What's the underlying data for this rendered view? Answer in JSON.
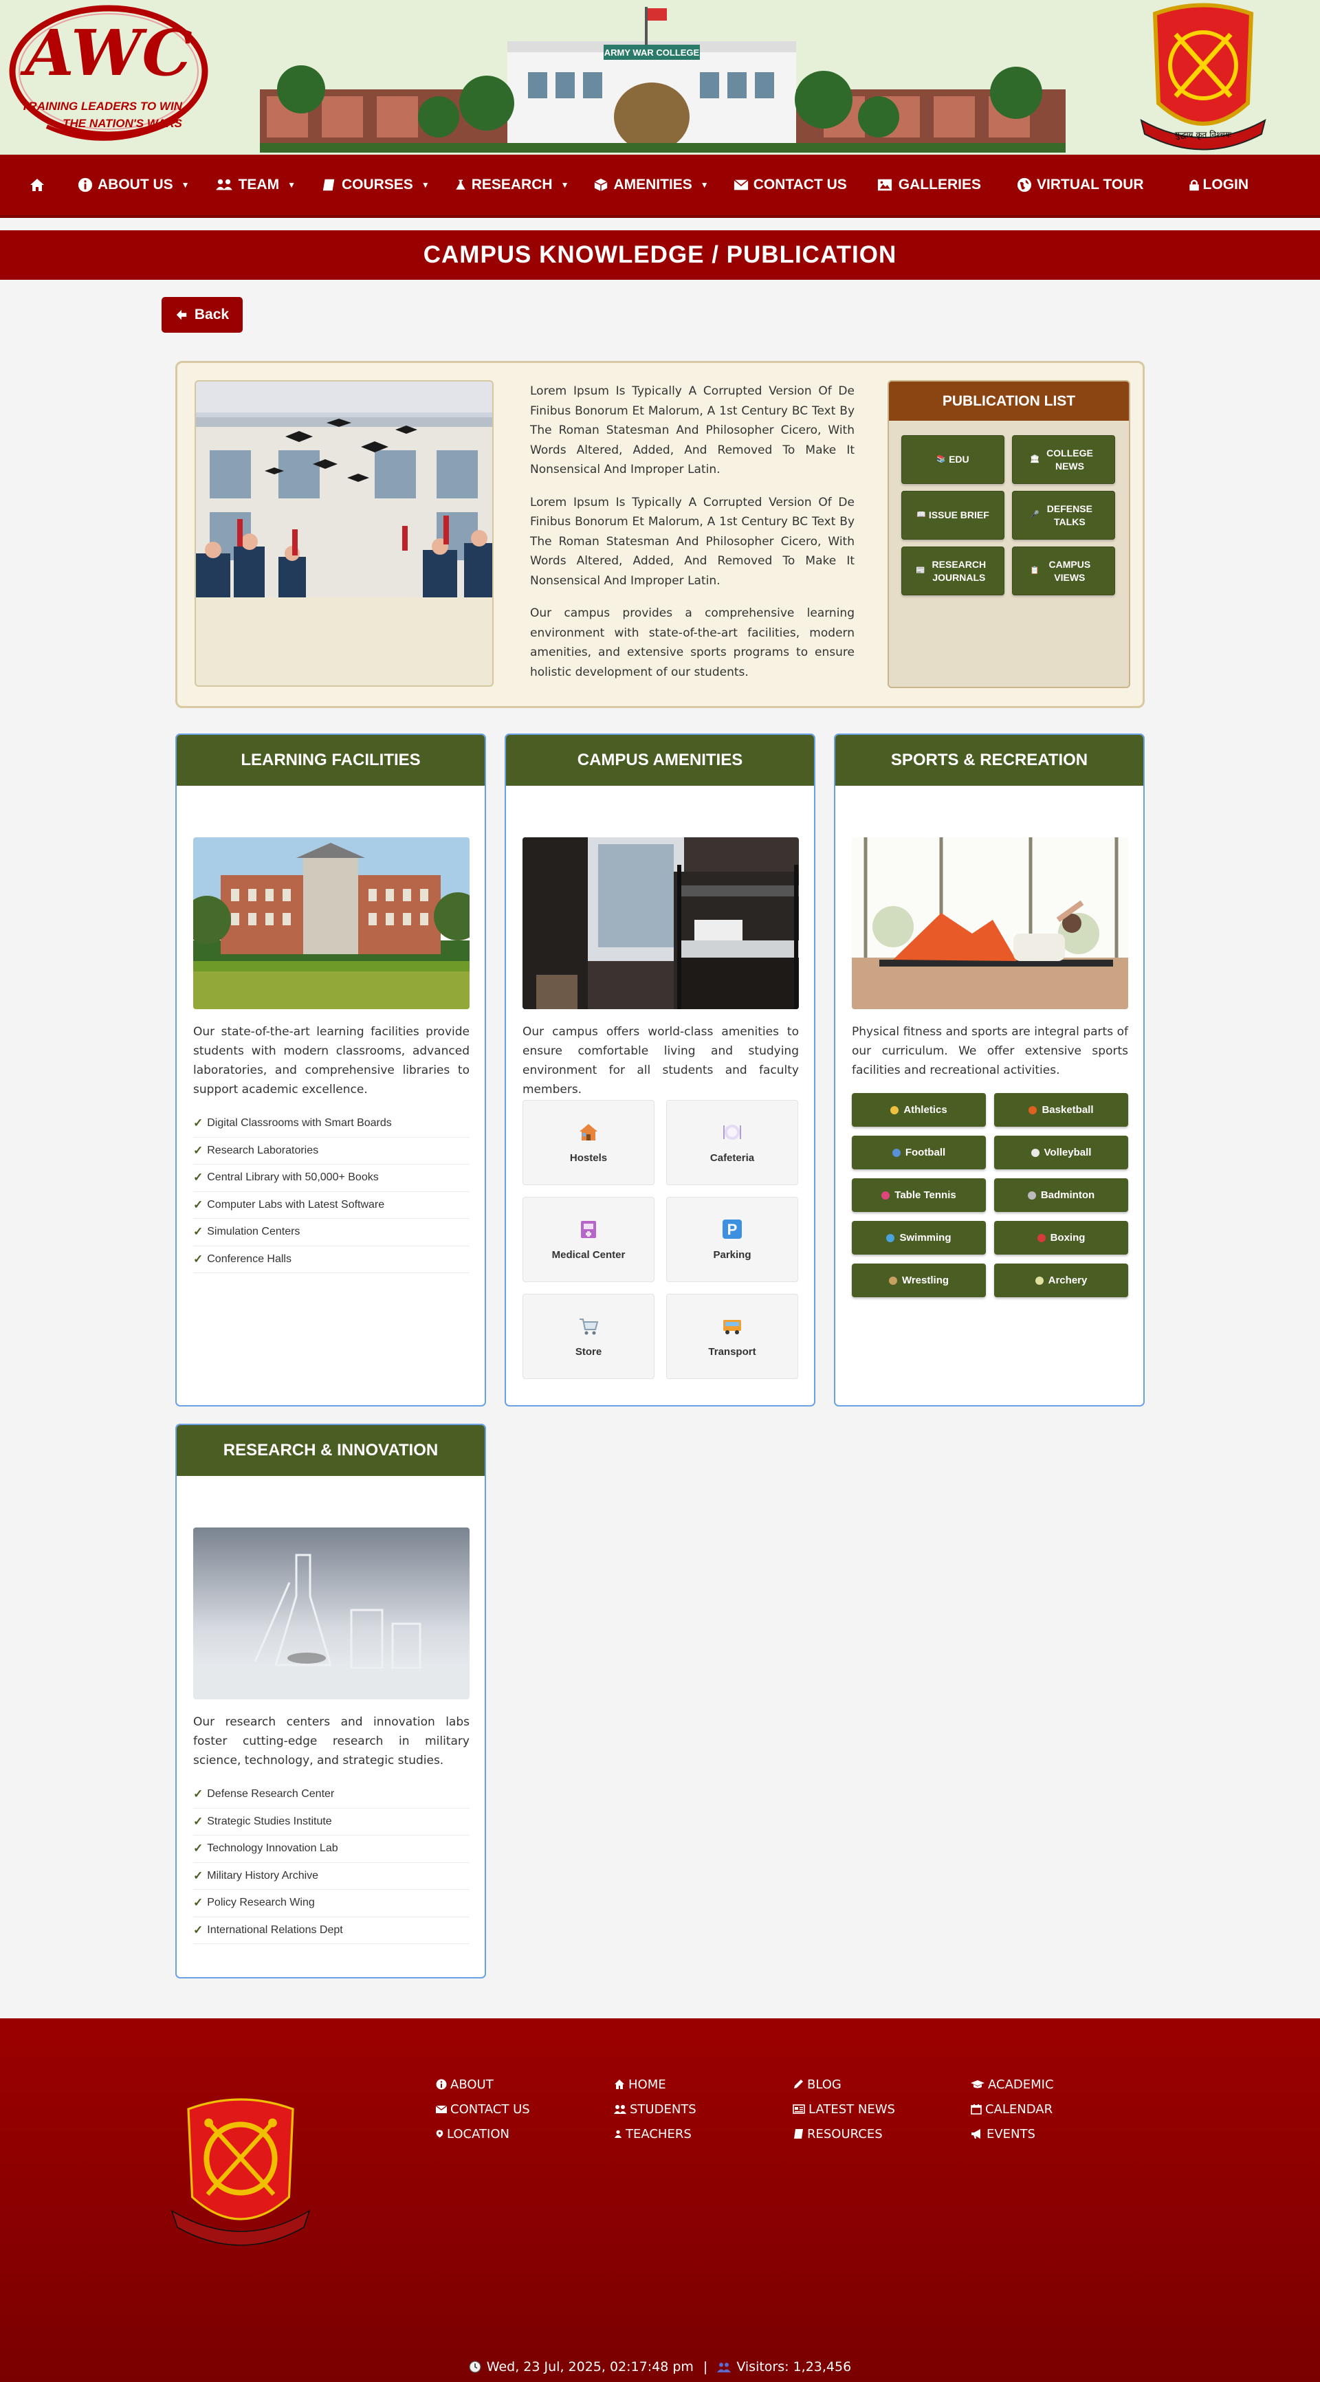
{
  "banner": {
    "logo_text": "AWC",
    "logo_tagline_1": "TRAINING LEADERS TO WIN",
    "logo_tagline_2": "THE NATION'S WARS",
    "college_sign": "ARMY WAR COLLEGE",
    "emblem_motto": "युद्धाय कृत निश्चयः"
  },
  "nav": {
    "home_icon": "home-icon",
    "items": [
      {
        "label": "ABOUT US",
        "icon": "info-circle-icon",
        "has_menu": true
      },
      {
        "label": "TEAM",
        "icon": "users-icon",
        "has_menu": true
      },
      {
        "label": "COURSES",
        "icon": "book-icon",
        "has_menu": true
      },
      {
        "label": "RESEARCH",
        "icon": "flask-icon",
        "has_menu": true
      },
      {
        "label": "AMENITIES",
        "icon": "cube-icon",
        "has_menu": true
      },
      {
        "label": "CONTACT US",
        "icon": "envelope-icon",
        "has_menu": false
      },
      {
        "label": "GALLERIES",
        "icon": "image-icon",
        "has_menu": false
      },
      {
        "label": "VIRTUAL TOUR",
        "icon": "globe-icon",
        "has_menu": false
      }
    ],
    "login": "LOGIN",
    "caret": "▼"
  },
  "page_title": "CAMPUS KNOWLEDGE / PUBLICATION",
  "back_label": "Back",
  "intro": {
    "paragraphs": [
      "Lorem Ipsum Is Typically A Corrupted Version Of De Finibus Bonorum Et Malorum, A 1st Century BC Text By The Roman Statesman And Philosopher Cicero, With Words Altered, Added, And Removed To Make It Nonsensical And Improper Latin.",
      "Lorem Ipsum Is Typically A Corrupted Version Of De Finibus Bonorum Et Malorum, A 1st Century BC Text By The Roman Statesman And Philosopher Cicero, With Words Altered, Added, And Removed To Make It Nonsensical And Improper Latin.",
      "Our campus provides a comprehensive learning environment with state-of-the-art facilities, modern amenities, and extensive sports programs to ensure holistic development of our students."
    ],
    "publication_list": {
      "title": "PUBLICATION LIST",
      "items": [
        {
          "label": "EDU",
          "icon": "📚"
        },
        {
          "label": "COLLEGE NEWS",
          "icon": "🏛"
        },
        {
          "label": "ISSUE BRIEF",
          "icon": "📖"
        },
        {
          "label": "DEFENSE TALKS",
          "icon": "🎤"
        },
        {
          "label": "RESEARCH JOURNALS",
          "icon": "📰"
        },
        {
          "label": "CAMPUS VIEWS",
          "icon": "📋"
        }
      ]
    }
  },
  "learning": {
    "title": "LEARNING FACILITIES",
    "description": "Our state-of-the-art learning facilities provide students with modern classrooms, advanced laboratories, and comprehensive libraries to support academic excellence.",
    "items": [
      "Digital Classrooms with Smart Boards",
      "Research Laboratories",
      "Central Library with 50,000+ Books",
      "Computer Labs with Latest Software",
      "Simulation Centers",
      "Conference Halls"
    ]
  },
  "amenities": {
    "title": "CAMPUS AMENITIES",
    "description": "Our campus offers world-class amenities to ensure comfortable living and studying environment for all students and faculty members.",
    "tiles": [
      {
        "label": "Hostels",
        "icon": "house-icon"
      },
      {
        "label": "Cafeteria",
        "icon": "plate-icon"
      },
      {
        "label": "Medical Center",
        "icon": "medical-icon"
      },
      {
        "label": "Parking",
        "icon": "parking-icon"
      },
      {
        "label": "Store",
        "icon": "cart-icon"
      },
      {
        "label": "Transport",
        "icon": "bus-icon"
      }
    ]
  },
  "sports": {
    "title": "SPORTS & RECREATION",
    "description": "Physical fitness and sports are integral parts of our curriculum. We offer extensive sports facilities and recreational activities.",
    "items": [
      {
        "label": "Athletics",
        "color": "#f0c040"
      },
      {
        "label": "Basketball",
        "color": "#e06020"
      },
      {
        "label": "Football",
        "color": "#5b8fd6"
      },
      {
        "label": "Volleyball",
        "color": "#e8e8e8"
      },
      {
        "label": "Table Tennis",
        "color": "#e0457a"
      },
      {
        "label": "Badminton",
        "color": "#bbbbbb"
      },
      {
        "label": "Swimming",
        "color": "#4aa3df"
      },
      {
        "label": "Boxing",
        "color": "#d63a3a"
      },
      {
        "label": "Wrestling",
        "color": "#c8a060"
      },
      {
        "label": "Archery",
        "color": "#e0e0a0"
      }
    ]
  },
  "research": {
    "title": "RESEARCH & INNOVATION",
    "description": "Our research centers and innovation labs foster cutting-edge research in military science, technology, and strategic studies.",
    "items": [
      "Defense Research Center",
      "Strategic Studies Institute",
      "Technology Innovation Lab",
      "Military History Archive",
      "Policy Research Wing",
      "International Relations Dept"
    ]
  },
  "footer": {
    "columns": [
      [
        {
          "label": "ABOUT",
          "icon": "info-icon"
        },
        {
          "label": "CONTACT US",
          "icon": "envelope-icon"
        },
        {
          "label": "LOCATION",
          "icon": "map-pin-icon"
        }
      ],
      [
        {
          "label": "HOME",
          "icon": "home-icon"
        },
        {
          "label": "STUDENTS",
          "icon": "users-icon"
        },
        {
          "label": "TEACHERS",
          "icon": "user-icon"
        }
      ],
      [
        {
          "label": "BLOG",
          "icon": "pencil-icon"
        },
        {
          "label": "LATEST NEWS",
          "icon": "newspaper-icon"
        },
        {
          "label": "RESOURCES",
          "icon": "book-icon"
        }
      ],
      [
        {
          "label": "ACADEMIC",
          "icon": "graduation-cap-icon"
        },
        {
          "label": "CALENDAR",
          "icon": "calendar-icon"
        },
        {
          "label": "EVENTS",
          "icon": "bullhorn-icon"
        }
      ]
    ],
    "datetime": "Wed, 23 Jul, 2025, 02:17:48 pm",
    "separator": "|",
    "visitors": "Visitors: 1,23,456"
  },
  "colors": {
    "primary_red": "#990000",
    "olive": "#4a5d23",
    "publication_brown": "#8b4513",
    "card_border": "#6aa0e6",
    "intro_bg": "#f7f2e2"
  }
}
